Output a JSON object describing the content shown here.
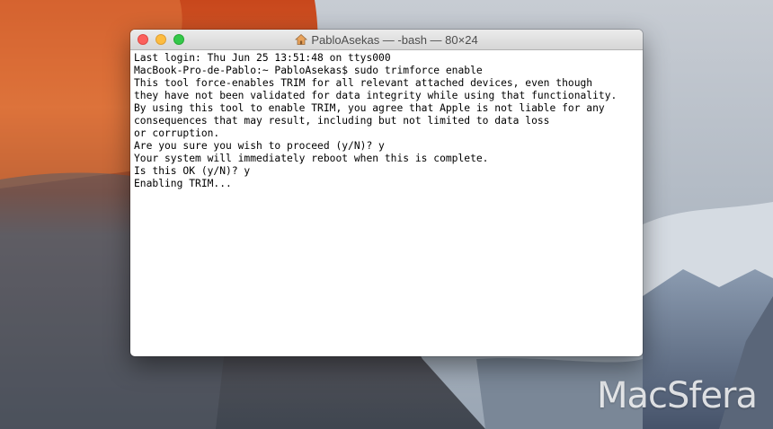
{
  "window": {
    "title": "PabloAsekas — -bash — 80×24",
    "title_icon": "home-icon"
  },
  "terminal": {
    "lines": [
      "Last login: Thu Jun 25 13:51:48 on ttys000",
      "MacBook-Pro-de-Pablo:~ PabloAsekas$ sudo trimforce enable",
      "This tool force-enables TRIM for all relevant attached devices, even though",
      "they have not been validated for data integrity while using that functionality.",
      "By using this tool to enable TRIM, you agree that Apple is not liable for any",
      "consequences that may result, including but not limited to data loss",
      "or corruption.",
      "Are you sure you wish to proceed (y/N)? y",
      "Your system will immediately reboot when this is complete.",
      "Is this OK (y/N)? y",
      "Enabling TRIM..."
    ]
  },
  "watermark": "MacSfera",
  "colors": {
    "close": "#fc605c",
    "minimize": "#fdbc40",
    "maximize": "#34c84a"
  }
}
